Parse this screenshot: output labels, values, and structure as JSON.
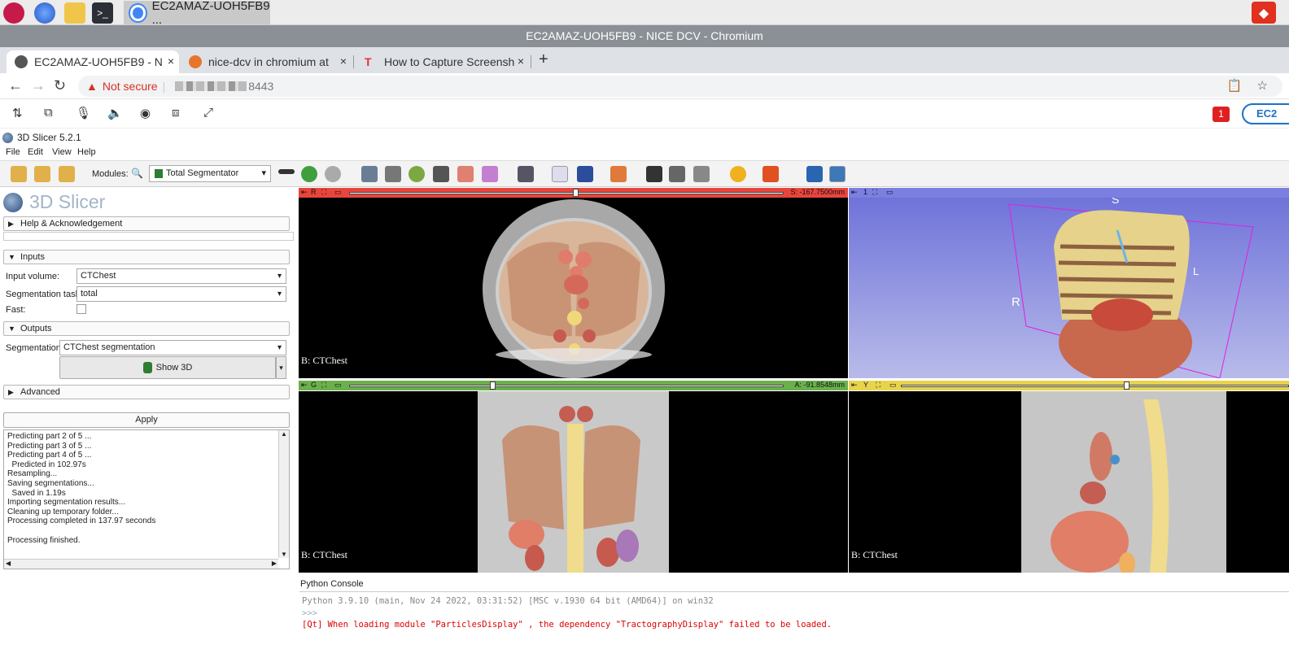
{
  "taskbar": {
    "active_window": "EC2AMAZ-UOH5FB9 ...",
    "icons": [
      "raspberry-icon",
      "globe-icon",
      "folder-icon",
      "terminal-icon",
      "chromium-icon",
      "dcv-icon"
    ]
  },
  "browser": {
    "window_title": "EC2AMAZ-UOH5FB9 - NICE DCV - Chromium",
    "tabs": [
      {
        "label": "EC2AMAZ-UOH5FB9 - N",
        "active": true
      },
      {
        "label": "nice-dcv in chromium at",
        "active": false
      },
      {
        "label": "How to Capture Screensh",
        "active": false
      }
    ],
    "new_tab": "+",
    "close": "×",
    "not_secure": "Not secure",
    "url_port": "8443"
  },
  "dcv": {
    "badge_count": "1",
    "user_label": "EC2"
  },
  "slicer": {
    "title": "3D Slicer 5.2.1",
    "menu": [
      "File",
      "Edit",
      "View",
      "Help"
    ],
    "modules_label": "Modules:",
    "module_selected": "Total Segmentator",
    "brand": "3D Slicer",
    "sections": {
      "help": "Help & Acknowledgement",
      "inputs": "Inputs",
      "outputs": "Outputs",
      "advanced": "Advanced"
    },
    "fields": {
      "input_volume_label": "Input volume:",
      "input_volume_value": "CTChest",
      "seg_task_label": "Segmentation task:",
      "seg_task_value": "total",
      "fast_label": "Fast:",
      "segmentation_label": "Segmentation:",
      "segmentation_value": "CTChest segmentation"
    },
    "show3d": "Show 3D",
    "apply": "Apply",
    "log": [
      "Predicting part 2 of 5 ...",
      "Predicting part 3 of 5 ...",
      "Predicting part 4 of 5 ...",
      "  Predicted in 102.97s",
      "Resampling...",
      "Saving segmentations...",
      "  Saved in 1.19s",
      "Importing segmentation results...",
      "Cleaning up temporary folder...",
      "Processing completed in 137.97 seconds",
      "",
      "Processing finished."
    ]
  },
  "views": {
    "red": {
      "letter": "R",
      "value": "S: -167.7500mm",
      "label": "B: CTChest",
      "color": "#e8453c",
      "slider_position": 0.52
    },
    "threed": {
      "letter": "1",
      "orient": [
        "S",
        "R",
        "L"
      ],
      "color": "#7b7fe0"
    },
    "green": {
      "letter": "G",
      "value": "A: -91.8548mm",
      "label": "B: CTChest",
      "color": "#6ab04c",
      "slider_position": 0.33
    },
    "yellow": {
      "letter": "Y",
      "label": "B: CTChest",
      "color": "#e8d44c",
      "slider_position": 0.58
    }
  },
  "python_console": {
    "title": "Python Console",
    "lines": [
      "Python 3.9.10 (main, Nov 24 2022, 03:31:52) [MSC v.1930 64 bit (AMD64)] on win32",
      ">>>",
      "[Qt] When loading module  \"ParticlesDisplay\" , the dependency \"TractographyDisplay\" failed to be loaded."
    ]
  }
}
